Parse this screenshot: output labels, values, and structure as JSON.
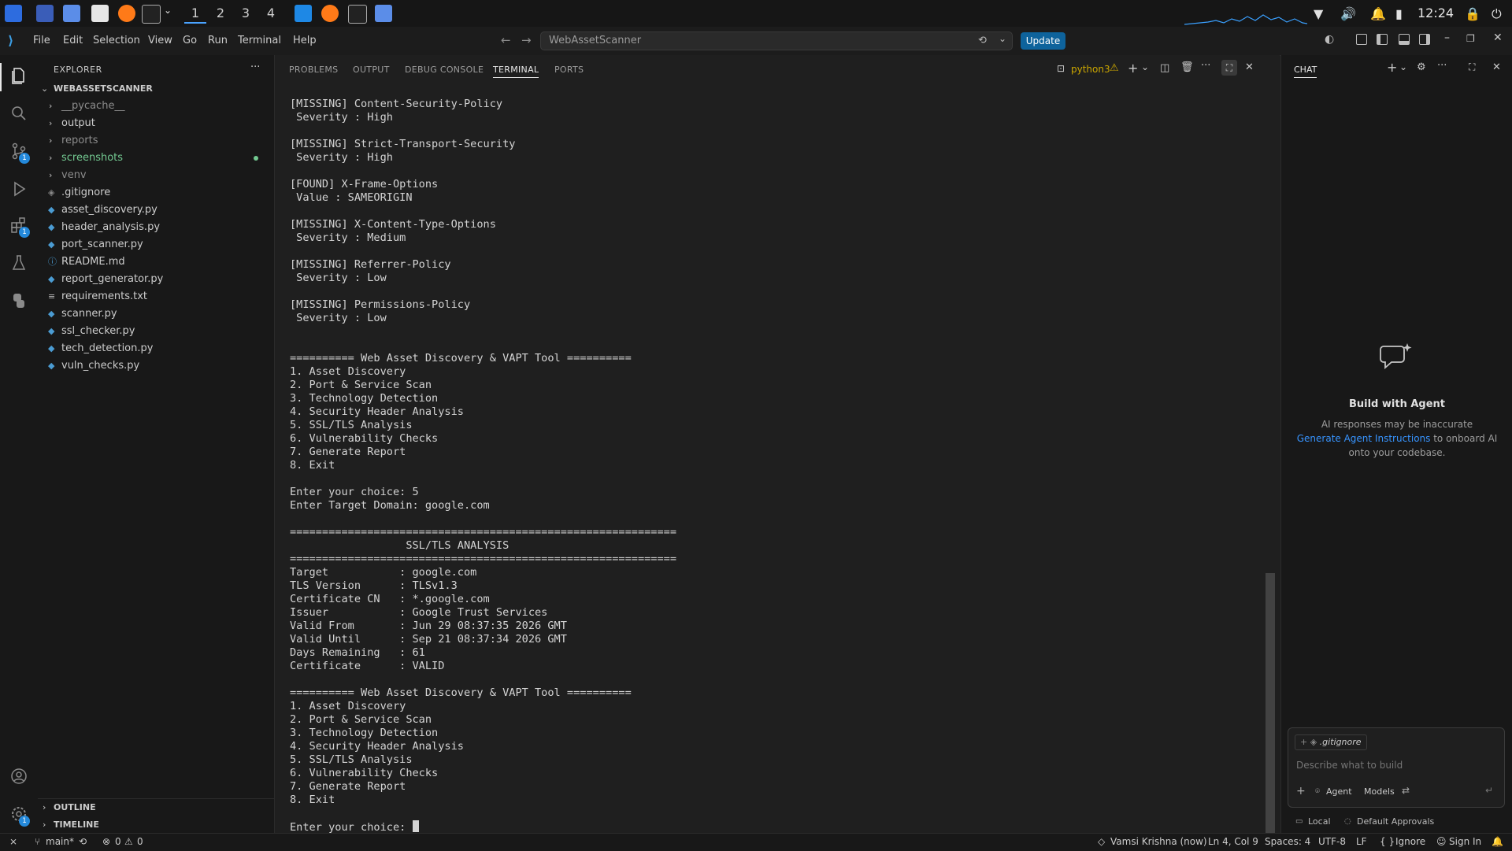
{
  "os_panel": {
    "workspaces": [
      "1",
      "2",
      "3",
      "4"
    ],
    "active_workspace": "1",
    "clock": "12:24"
  },
  "titlebar": {
    "menu": [
      "File",
      "Edit",
      "Selection",
      "View",
      "Go",
      "Run",
      "Terminal",
      "Help"
    ],
    "command_center": "WebAssetScanner",
    "update_label": "Update"
  },
  "activity_badges": {
    "source_control": "1",
    "extensions": "1",
    "settings": "1"
  },
  "explorer": {
    "title": "EXPLORER",
    "root": "WEBASSETSCANNER",
    "folders": [
      "__pycache__",
      "output",
      "reports",
      "screenshots",
      "venv"
    ],
    "files": [
      ".gitignore",
      "asset_discovery.py",
      "header_analysis.py",
      "port_scanner.py",
      "README.md",
      "report_generator.py",
      "requirements.txt",
      "scanner.py",
      "ssl_checker.py",
      "tech_detection.py",
      "vuln_checks.py"
    ],
    "outline": "OUTLINE",
    "timeline": "TIMELINE"
  },
  "panel": {
    "tabs": [
      "PROBLEMS",
      "OUTPUT",
      "DEBUG CONSOLE",
      "TERMINAL",
      "PORTS"
    ],
    "active_tab": "TERMINAL",
    "shell_label": "python3",
    "terminal_text": "[MISSING] Content-Security-Policy\n Severity : High\n\n[MISSING] Strict-Transport-Security\n Severity : High\n\n[FOUND] X-Frame-Options\n Value : SAMEORIGIN\n\n[MISSING] X-Content-Type-Options\n Severity : Medium\n\n[MISSING] Referrer-Policy\n Severity : Low\n\n[MISSING] Permissions-Policy\n Severity : Low\n\n\n========== Web Asset Discovery & VAPT Tool ==========\n1. Asset Discovery\n2. Port & Service Scan\n3. Technology Detection\n4. Security Header Analysis\n5. SSL/TLS Analysis\n6. Vulnerability Checks\n7. Generate Report\n8. Exit\n\nEnter your choice: 5\nEnter Target Domain: google.com\n\n============================================================\n                  SSL/TLS ANALYSIS\n============================================================\nTarget           : google.com\nTLS Version      : TLSv1.3\nCertificate CN   : *.google.com\nIssuer           : Google Trust Services\nValid From       : Jun 29 08:37:35 2026 GMT\nValid Until      : Sep 21 08:37:34 2026 GMT\nDays Remaining   : 61\nCertificate      : VALID\n\n========== Web Asset Discovery & VAPT Tool ==========\n1. Asset Discovery\n2. Port & Service Scan\n3. Technology Detection\n4. Security Header Analysis\n5. SSL/TLS Analysis\n6. Vulnerability Checks\n7. Generate Report\n8. Exit\n\n",
    "prompt": "Enter your choice: "
  },
  "chat": {
    "title": "CHAT",
    "heading": "Build with Agent",
    "line1": "AI responses may be inaccurate",
    "link": "Generate Agent Instructions",
    "line2_rest": " to onboard AI",
    "line3": "onto your codebase.",
    "context_file": ".gitignore",
    "input_placeholder": "Describe what to build",
    "agent_label": "Agent",
    "models_label": "Models",
    "local_label": "Local",
    "approvals_label": "Default Approvals"
  },
  "status": {
    "branch": "main*",
    "errors": "0",
    "warnings": "0",
    "author": "Vamsi Krishna (now)",
    "position": "Ln 4, Col 9",
    "spaces": "Spaces: 4",
    "encoding": "UTF-8",
    "eol": "LF",
    "language": "Ignore",
    "sign_in": "Sign In"
  },
  "colors": {
    "accent": "#0e639c",
    "untracked": "#73c991",
    "badge": "#2489db",
    "link": "#3794ff"
  }
}
